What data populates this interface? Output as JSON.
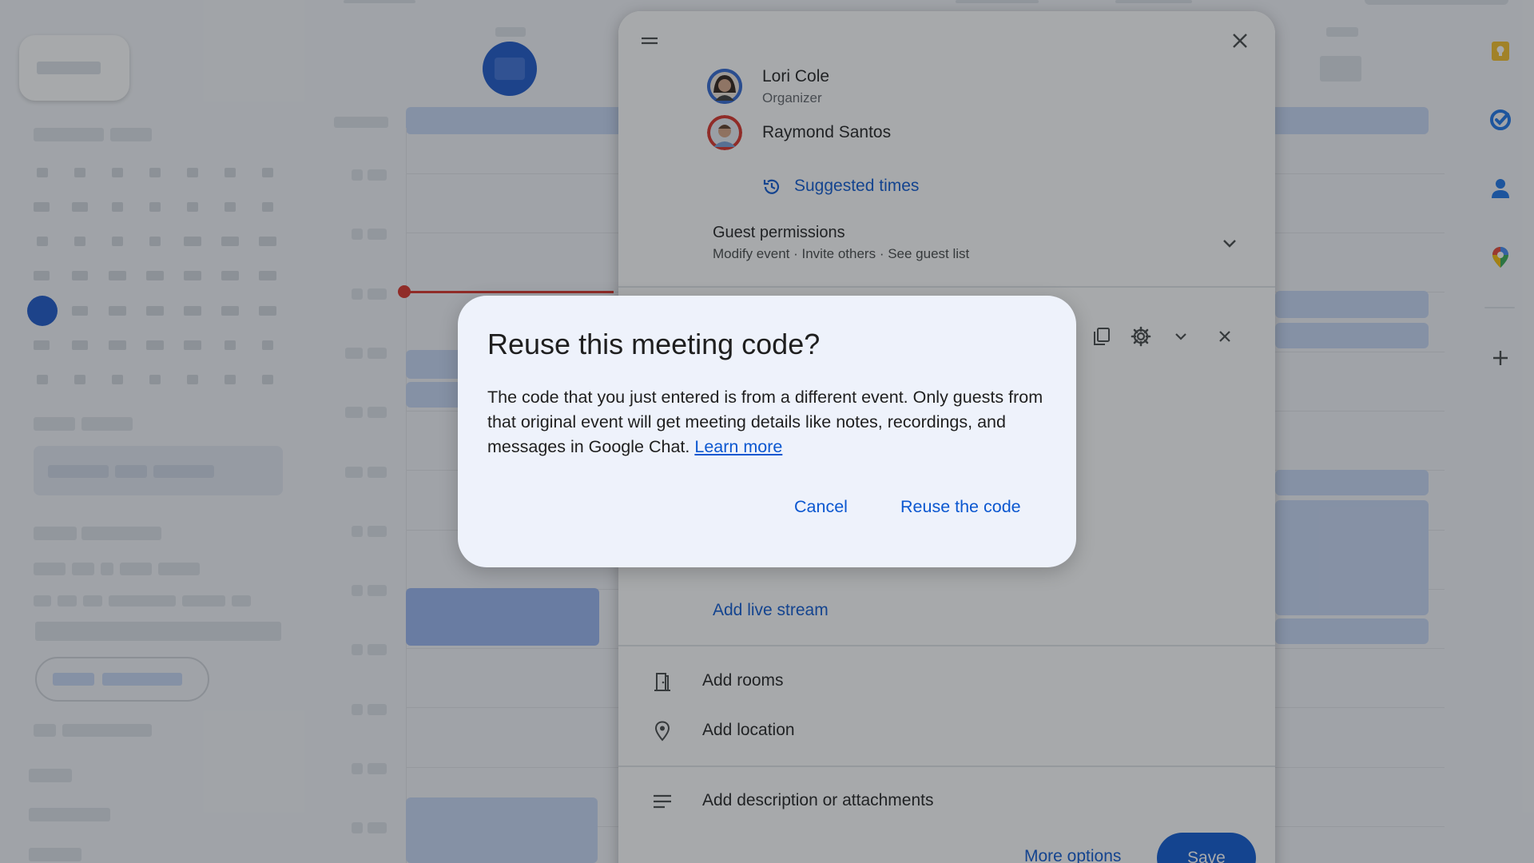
{
  "event_panel": {
    "guests": [
      {
        "name": "Lori Cole",
        "role": "Organizer"
      },
      {
        "name": "Raymond Santos",
        "role": ""
      }
    ],
    "suggested_times": "Suggested times",
    "guest_permissions": {
      "title": "Guest permissions",
      "summary": "Modify event · Invite others · See guest list"
    },
    "add_live_stream": "Add live stream",
    "add_rooms": "Add rooms",
    "add_location": "Add location",
    "add_description": "Add description or attachments",
    "more_options": "More options",
    "save": "Save"
  },
  "dialog": {
    "title": "Reuse this meeting code?",
    "body": "The code that you just entered is from a different event. Only guests from that original event will get meeting details like notes, recordings, and messages in Google Chat.",
    "learn_more": "Learn more",
    "cancel": "Cancel",
    "confirm": "Reuse the code"
  },
  "colors": {
    "accent": "#0b57d0",
    "save_button": "#0b57d0",
    "now_line": "#d93025",
    "dialog_bg": "#eef2fb"
  },
  "icons": {
    "drag_handle": "drag-handle-icon",
    "close": "close-icon",
    "history": "history-icon",
    "expand": "chevron-down-icon",
    "copy": "copy-icon",
    "settings": "gear-icon",
    "room": "door-icon",
    "location": "location-pin-icon",
    "description": "notes-icon",
    "rail": [
      "keep-icon",
      "tasks-icon",
      "contacts-icon",
      "maps-icon",
      "add-icon"
    ]
  }
}
